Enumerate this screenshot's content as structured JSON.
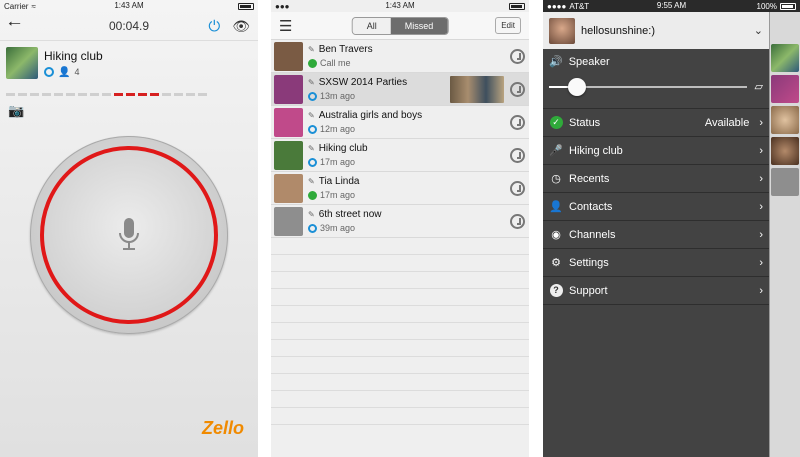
{
  "phone1": {
    "status": {
      "carrier": "Carrier",
      "time": "1:43 AM"
    },
    "timer": "00:04.9",
    "channel": {
      "name": "Hiking club",
      "users": "4"
    },
    "signal_levels": [
      0,
      0,
      0,
      0,
      0,
      0,
      0,
      0,
      0,
      1,
      1,
      1,
      1,
      0,
      0,
      0,
      0
    ],
    "brand": {
      "z": "Zello",
      "suffix": ""
    },
    "icons": [
      "back-arrow-icon",
      "power-icon",
      "eye-icon",
      "camera-icon",
      "microphone-icon"
    ]
  },
  "phone2": {
    "status": {
      "time": "1:43 AM"
    },
    "tabs": [
      "All",
      "Missed"
    ],
    "active_tab": "Missed",
    "edit_label": "Edit",
    "rows": [
      {
        "name": "Ben Travers",
        "sub": "Call me",
        "status_icon": "check-green-icon",
        "color": "#7a5b44"
      },
      {
        "name": "SXSW 2014 Parties",
        "sub": "13m ago",
        "status_icon": "blue-ring-icon",
        "color": "#8a3a7a",
        "highlight": true
      },
      {
        "name": "Australia girls and boys",
        "sub": "12m ago",
        "status_icon": "dashed-ring-icon",
        "color": "#c04a8a"
      },
      {
        "name": "Hiking club",
        "sub": "17m ago",
        "status_icon": "blue-ring-icon",
        "color": "#4a7a3a"
      },
      {
        "name": "Tia Linda",
        "sub": "17m ago",
        "status_icon": "check-green-icon",
        "color": "#b08a6a"
      },
      {
        "name": "6th street now",
        "sub": "39m ago",
        "status_icon": "blue-ring-icon",
        "color": "#8e8e8e"
      }
    ]
  },
  "phone3": {
    "status": {
      "carrier": "AT&T",
      "time": "9:55 AM",
      "battery": "100%"
    },
    "username": "hellosunshine:)",
    "speaker_label": "Speaker",
    "speaker_level": 0.14,
    "menu": [
      {
        "label": "Status",
        "value": "Available",
        "icon": "status-check-icon"
      },
      {
        "label": "Hiking club",
        "value": "",
        "icon": "mic-icon"
      },
      {
        "label": "Recents",
        "value": "",
        "icon": "clock-icon"
      },
      {
        "label": "Contacts",
        "value": "",
        "icon": "person-icon"
      },
      {
        "label": "Channels",
        "value": "",
        "icon": "channel-icon"
      },
      {
        "label": "Settings",
        "value": "",
        "icon": "gear-icon"
      },
      {
        "label": "Support",
        "value": "",
        "icon": "help-icon"
      }
    ]
  }
}
